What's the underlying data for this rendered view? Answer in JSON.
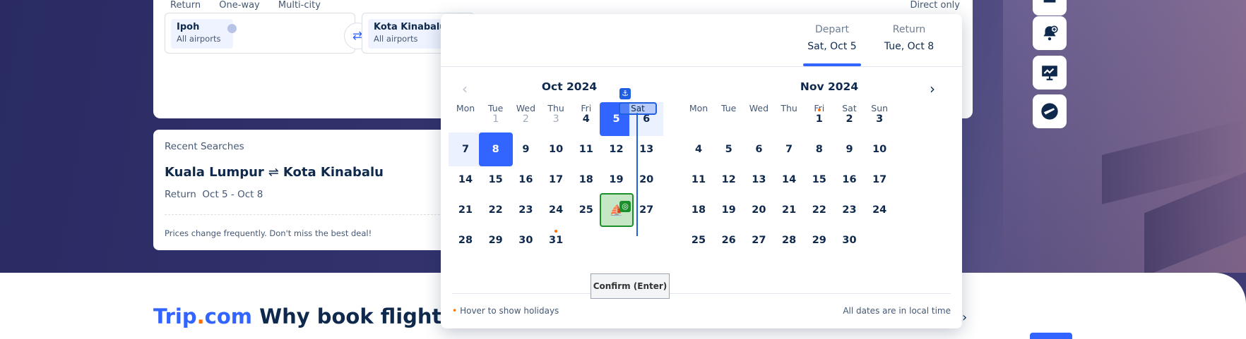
{
  "search": {
    "trip_options": [
      "Return",
      "One-way",
      "Multi-city"
    ],
    "direct_only": "Direct only",
    "from": {
      "city": "Ipoh",
      "sub": "All airports"
    },
    "to": {
      "city": "Kota Kinabalu",
      "sub": "All airports"
    }
  },
  "recent": {
    "title": "Recent Searches",
    "origin": "Kuala Lumpur",
    "destination": "Kota Kinabalu",
    "type": "Return",
    "dates": "Oct 5 - Oct 8",
    "note": "Prices change frequently. Don't miss the best deal!"
  },
  "headline": {
    "brand_a": "Trip",
    "brand_dot": ".",
    "brand_b": "com",
    "text": "Why book flights with"
  },
  "calendar": {
    "depart_label": "Depart",
    "depart_value": "Sat, Oct 5",
    "return_label": "Return",
    "return_value": "Tue, Oct 8",
    "weekdays": [
      "Mon",
      "Tue",
      "Wed",
      "Thu",
      "Fri",
      "Sat",
      "Sun"
    ],
    "month1": "Oct 2024",
    "month2": "Nov 2024",
    "footer_left": "Hover to show holidays",
    "footer_right": "All dates are in local time",
    "confirm_tooltip": "Confirm (Enter)",
    "selected_depart_day": 5,
    "selected_return_day": 8,
    "hover_day": 26,
    "sat_header": "Sat"
  },
  "colors": {
    "accent": "#3264ff",
    "holiday": "#ff6f00",
    "hover_green": "#1a8f2c"
  },
  "icons": {
    "side": [
      "bell-plus-icon",
      "price-chart-icon",
      "flight-status-icon"
    ]
  }
}
